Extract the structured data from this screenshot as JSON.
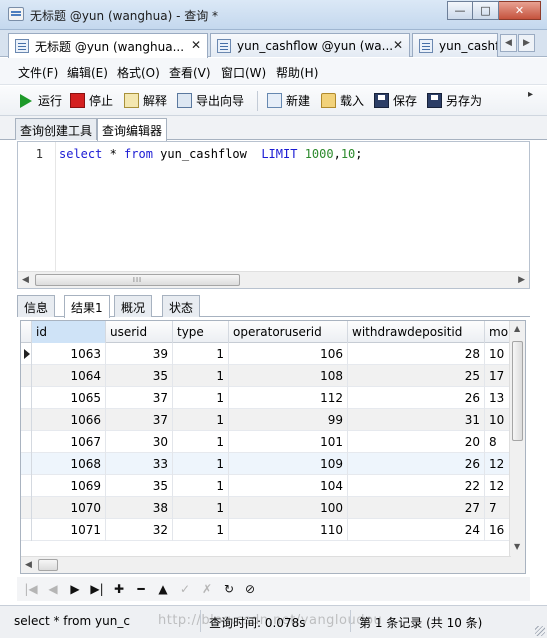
{
  "window": {
    "title": "无标题 @yun (wanghua) - 查询 *",
    "buttons": {
      "minimize": "—",
      "maximize": "□",
      "close": "✕"
    }
  },
  "doc_tabs": [
    {
      "label": "无标题 @yun (wanghua...",
      "close": "✕"
    },
    {
      "label": "yun_cashflow @yun (wa...",
      "close": "✕"
    },
    {
      "label": "yun_cashfl"
    }
  ],
  "tab_nav": {
    "prev": "◀",
    "next": "▶"
  },
  "menu": [
    "文件(F)",
    "编辑(E)",
    "格式(O)",
    "查看(V)",
    "窗口(W)",
    "帮助(H)"
  ],
  "toolbar": {
    "run": "运行",
    "stop": "停止",
    "explain": "解释",
    "export": "导出向导",
    "new": "新建",
    "load": "载入",
    "save": "保存",
    "saveas": "另存为",
    "more": "▸"
  },
  "query_tabs": [
    "查询创建工具",
    "查询编辑器"
  ],
  "editor": {
    "line_number": "1",
    "code": {
      "kw_select": "select",
      "star": " * ",
      "kw_from": "from",
      "table": " yun_cashflow  ",
      "kw_limit": "LIMIT",
      "space": " ",
      "n1": "1000",
      "comma": ",",
      "n2": "10",
      "end": ";"
    },
    "scroll_grip": "III"
  },
  "result_tabs": [
    "信息",
    "结果1",
    "概况",
    "状态"
  ],
  "grid": {
    "columns": [
      "id",
      "userid",
      "type",
      "operatoruserid",
      "withdrawdepositid",
      "mo"
    ],
    "rows": [
      [
        "1063",
        "39",
        "1",
        "106",
        "28",
        "10"
      ],
      [
        "1064",
        "35",
        "1",
        "108",
        "25",
        "17"
      ],
      [
        "1065",
        "37",
        "1",
        "112",
        "26",
        "13"
      ],
      [
        "1066",
        "37",
        "1",
        "99",
        "31",
        "10"
      ],
      [
        "1067",
        "30",
        "1",
        "101",
        "20",
        "8"
      ],
      [
        "1068",
        "33",
        "1",
        "109",
        "26",
        "12"
      ],
      [
        "1069",
        "35",
        "1",
        "104",
        "22",
        "12"
      ],
      [
        "1070",
        "38",
        "1",
        "100",
        "27",
        "7"
      ],
      [
        "1071",
        "32",
        "1",
        "110",
        "24",
        "16"
      ]
    ],
    "scroll": {
      "up": "▲",
      "down": "▼",
      "left": "◀",
      "right": "▶"
    }
  },
  "nav_buttons": {
    "first": "|◀",
    "prev": "◀",
    "next": "▶",
    "last": "▶|",
    "add": "✚",
    "remove": "━",
    "up": "▲",
    "apply": "✓",
    "cancel": "✗",
    "refresh": "↻",
    "stop": "⊘"
  },
  "status": {
    "sql": "select * from yun_c",
    "time": "查询时间: 0.078s",
    "records": "第 1 条记录 (共 10 条)"
  },
  "watermark": "http://blog.csdn.net/yangloudou"
}
